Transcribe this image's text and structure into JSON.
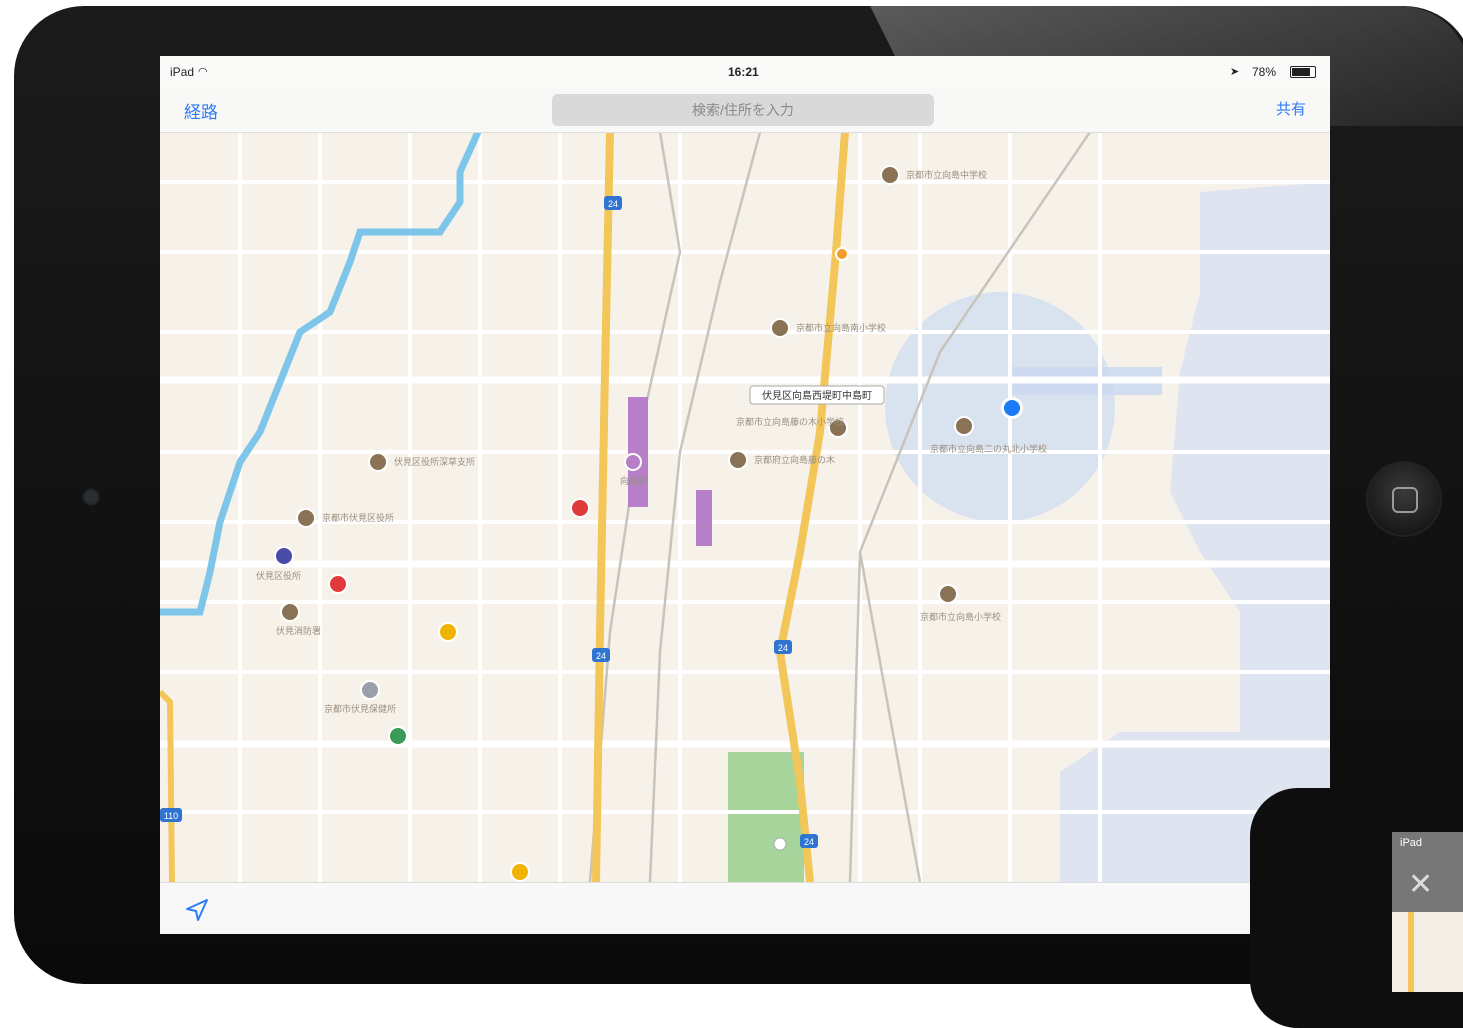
{
  "status_bar": {
    "carrier": "iPad",
    "time": "16:21",
    "battery": "78%"
  },
  "nav_bar": {
    "directions_label": "経路",
    "search_placeholder": "検索/住所を入力",
    "share_label": "共有"
  },
  "map": {
    "area_label": "伏見区向島西堤町中島町",
    "poi_labels": [
      "京都市立向島中学校",
      "京都市立向島南小学校",
      "京都市立向島藤の木小学校",
      "向島駅",
      "京都府立向島藤の木",
      "京都市立向島二の丸北小学校",
      "伏見区役所深草支所",
      "京都市伏見区役所",
      "京都市立向島小学校",
      "伏見区役所",
      "伏見消防署",
      "京都市伏見保健所"
    ],
    "route_numbers": [
      "24",
      "24",
      "24",
      "24",
      "110"
    ]
  },
  "bottom_bar": {
    "location_icon": "location-arrow-icon"
  },
  "phone": {
    "carrier": "iPad",
    "close_icon": "close-icon"
  }
}
